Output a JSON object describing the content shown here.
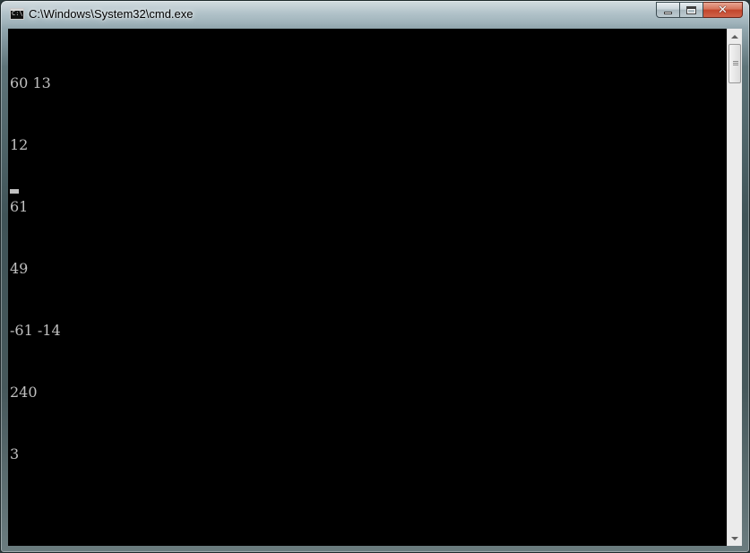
{
  "window": {
    "title": "C:\\Windows\\System32\\cmd.exe",
    "icon": "cmd-icon",
    "icon_text": "C:\\"
  },
  "caption_buttons": {
    "minimize_icon": "minimize-icon",
    "maximize_icon": "maximize-icon",
    "close_icon": "close-icon",
    "close_glyph": "✕"
  },
  "console": {
    "lines": [
      "60 13",
      "12",
      "61",
      "49",
      "-61 -14",
      "240",
      "3"
    ],
    "text_color": "#c0c0c0",
    "background": "#000000"
  }
}
